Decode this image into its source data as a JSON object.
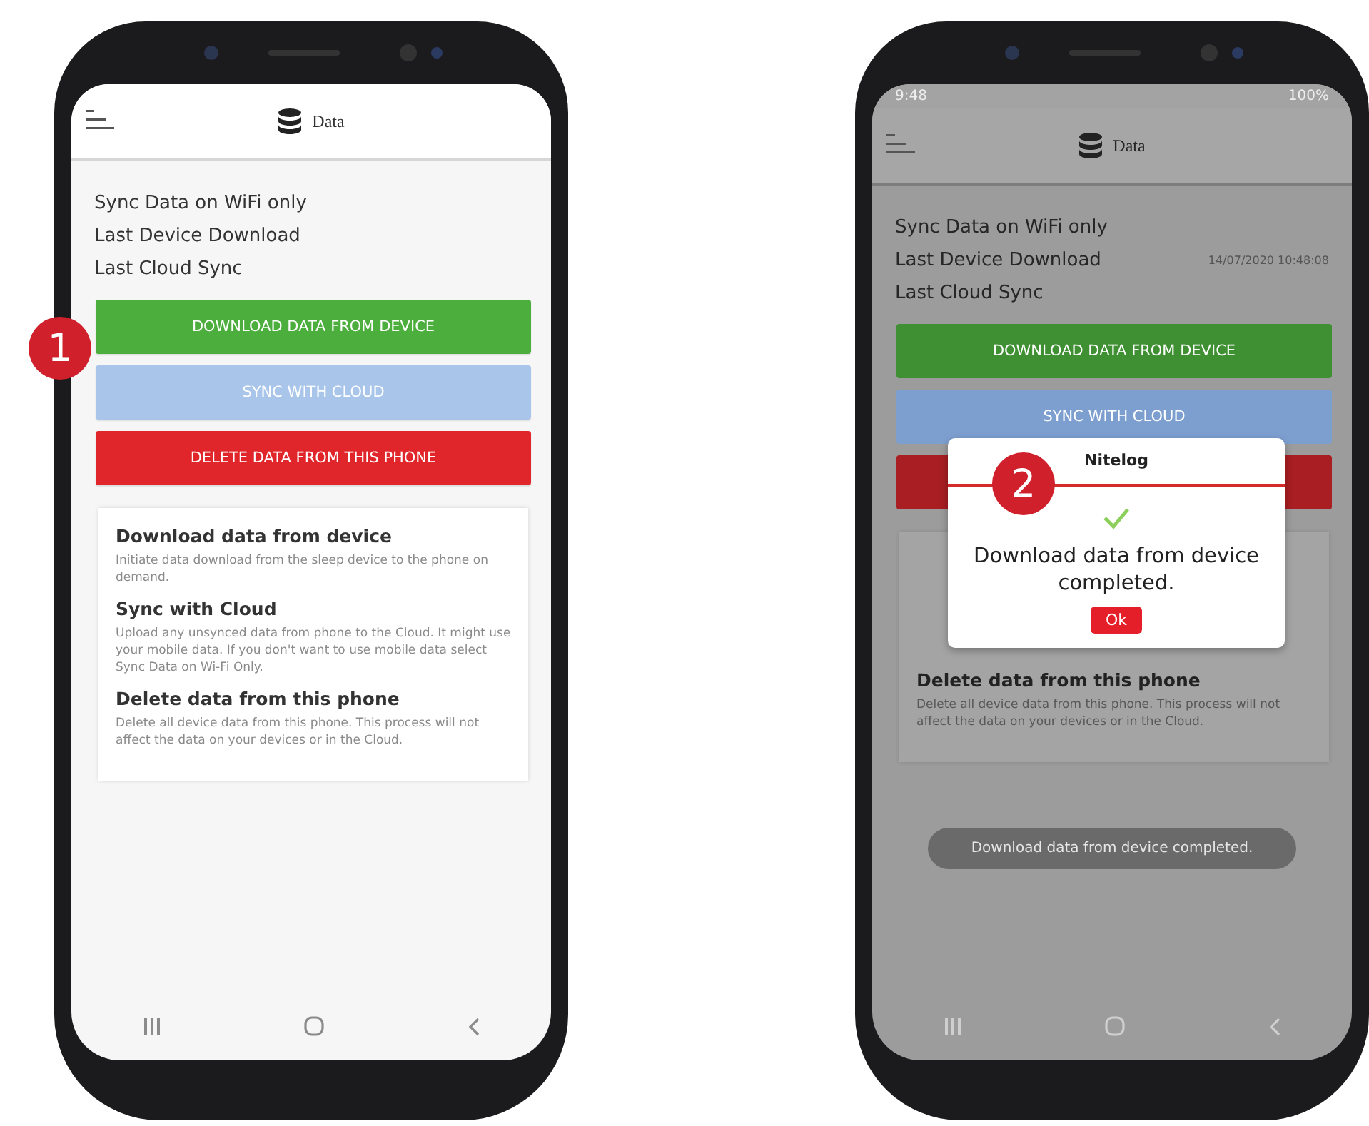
{
  "phones": [
    {
      "dimmed": false,
      "callout": "1",
      "header": {
        "title": "Data"
      },
      "settings": [
        {
          "label": "Sync Data on WiFi only"
        },
        {
          "label": "Last Device Download"
        },
        {
          "label": "Last Cloud Sync"
        }
      ],
      "buttons": [
        {
          "label": "DOWNLOAD DATA FROM DEVICE",
          "color": "#4cae3c"
        },
        {
          "label": "SYNC WITH CLOUD",
          "color": "#a9c6ea"
        },
        {
          "label": "DELETE DATA FROM THIS PHONE",
          "color": "#e0262a"
        }
      ],
      "info_card": {
        "sections": [
          {
            "heading": "Download data from device",
            "text": "Initiate data download from the sleep device to the phone on demand."
          },
          {
            "heading": "Sync with Cloud",
            "text": "Upload any unsynced data from phone to the Cloud. It might use your mobile data. If you don't want to use mobile data select Sync Data on Wi-Fi Only."
          },
          {
            "heading": "Delete data from this phone",
            "text": "Delete all device data from this phone. This process will not affect the data on your devices or in the Cloud."
          }
        ]
      }
    },
    {
      "dimmed": true,
      "status_bar": {
        "time": "9:48",
        "battery": "100%"
      },
      "header": {
        "title": "Data"
      },
      "settings": [
        {
          "label": "Sync Data on WiFi only"
        },
        {
          "label": "Last Device Download",
          "value": "14/07/2020 10:48:08"
        },
        {
          "label": "Last Cloud Sync"
        }
      ],
      "buttons": [
        {
          "label": "DOWNLOAD DATA FROM DEVICE",
          "color": "#3f8f33"
        },
        {
          "label": "SYNC WITH CLOUD",
          "color": "#7d9fd0"
        },
        {
          "color": "#a81e22"
        }
      ],
      "info_card": {
        "sections": [
          {
            "heading": "Delete data from this phone",
            "text": "Delete all device data from this phone. This process will not affect the data on your devices or in the Cloud."
          }
        ]
      },
      "dialog": {
        "title": "Nitelog",
        "callout": "2",
        "message": "Download data from device completed.",
        "button": "Ok"
      },
      "toast": "Download data from device completed."
    }
  ]
}
